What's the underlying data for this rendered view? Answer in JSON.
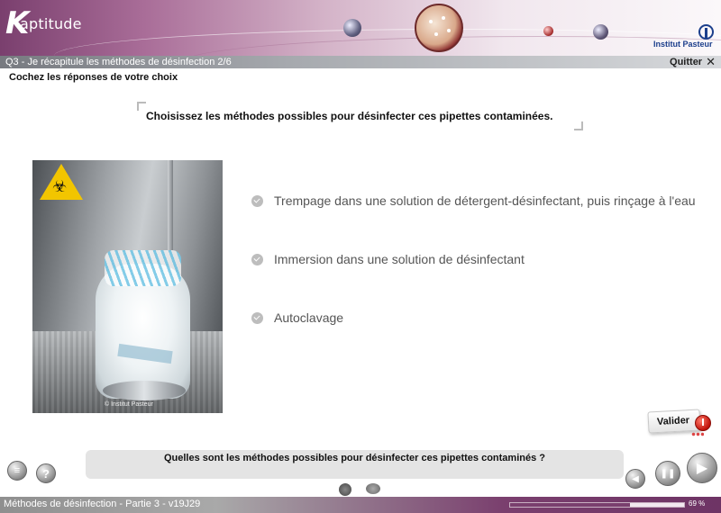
{
  "header": {
    "logo_k": "K",
    "logo_rest": "aptitude",
    "partner": "Institut Pasteur"
  },
  "titlebar": {
    "question": "Q3 - Je récapitule les méthodes de désinfection 2/6",
    "quit_label": "Quitter",
    "quit_icon": "✕"
  },
  "instruction": "Cochez les réponses de votre choix",
  "question_text": "Choisissez les méthodes possibles pour désinfecter ces pipettes contaminées.",
  "photo": {
    "hazard_symbol": "☣",
    "copyright": "© Institut Pasteur"
  },
  "options": [
    {
      "label": "Trempage dans une solution de détergent-désinfectant, puis rinçage à l'eau",
      "checked": false
    },
    {
      "label": "Immersion dans une solution de désinfectant",
      "checked": false
    },
    {
      "label": "Autoclavage",
      "checked": false
    }
  ],
  "validate_label": "Valider",
  "bottom_question": "Quelles sont les méthodes possibles pour désinfecter ces pipettes contaminés ?",
  "controls": {
    "menu_icon": "menu-icon",
    "help_icon": "help-icon",
    "help_glyph": "?",
    "prev_glyph": "◀",
    "pause_glyph": "❚❚",
    "play_glyph": "▶"
  },
  "footer": {
    "course_title": "Méthodes de désinfection - Partie 3 - v19J29",
    "progress_percent": 69,
    "progress_label": "69 %"
  },
  "colors": {
    "brand": "#7a3f6e",
    "validate_red": "#c1120a",
    "pasteur_blue": "#1c3f8c"
  }
}
